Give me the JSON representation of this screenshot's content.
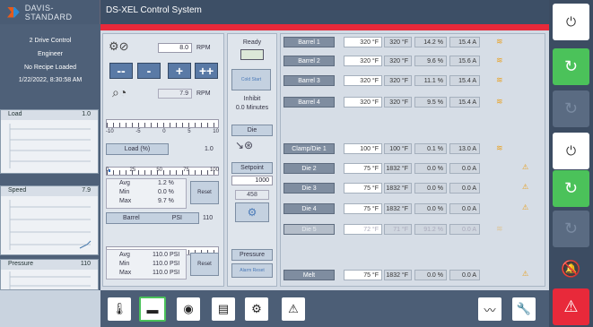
{
  "header": {
    "logo_text": "DAVIS-STANDARD",
    "title": "DS-XEL Control System"
  },
  "sidebar": {
    "system": "2 Drive Control",
    "user": "Engineer",
    "recipe": "No Recipe Loaded",
    "datetime": "1/22/2022, 8:30:58 AM",
    "graphs": [
      {
        "label": "Load",
        "value": "1.0"
      },
      {
        "label": "Speed",
        "value": "7.9"
      },
      {
        "label": "Pressure",
        "value": "110"
      }
    ]
  },
  "drive": {
    "setpoint": "8.0",
    "setpoint_unit": "RPM",
    "actual": "7.9",
    "actual_unit": "RPM",
    "btn_fast_down": "--",
    "btn_down": "-",
    "btn_up": "+",
    "btn_fast_up": "++",
    "scale_top": [
      "-10",
      "-5",
      "0",
      "5",
      "10"
    ],
    "load_label": "Load (%)",
    "load_value": "1.0",
    "load_scale": [
      "0",
      "25",
      "50",
      "75",
      "100"
    ],
    "stats": {
      "avg_label": "Avg",
      "min_label": "Min",
      "max_label": "Max",
      "avg": "1.2 %",
      "min": "0.0 %",
      "max": "9.7 %"
    },
    "reset": "Reset",
    "barrel_label": "Barrel",
    "psi_label": "PSI",
    "barrel_value": "110",
    "pressure_stats": {
      "avg": "110.0 PSI",
      "min": "110.0 PSI",
      "max": "110.0 PSI"
    }
  },
  "status": {
    "ready": "Ready",
    "cold_start": "Cold Start",
    "inhibit": "Inhibit",
    "inhibit_time": "0.0 Minutes",
    "die": "Die",
    "setpoint_label": "Setpoint",
    "setpoint_value": "1000",
    "die_value": "458",
    "pressure": "Pressure",
    "alarm_reset": "Alarm Reset"
  },
  "zones": [
    {
      "name": "Barrel 1",
      "set": "320 °F",
      "act": "320 °F",
      "pct": "14.2 %",
      "amp": "15.4 A",
      "icon": "heat"
    },
    {
      "name": "Barrel 2",
      "set": "320 °F",
      "act": "320 °F",
      "pct": "9.6 %",
      "amp": "15.6 A",
      "icon": "heat"
    },
    {
      "name": "Barrel 3",
      "set": "320 °F",
      "act": "320 °F",
      "pct": "11.1 %",
      "amp": "15.4 A",
      "icon": "heat"
    },
    {
      "name": "Barrel 4",
      "set": "320 °F",
      "act": "320 °F",
      "pct": "9.5 %",
      "amp": "15.4 A",
      "icon": "heat"
    },
    {
      "name": "Clamp/Die 1",
      "set": "100 °F",
      "act": "100 °F",
      "pct": "0.1 %",
      "amp": "13.0 A",
      "icon": "heat"
    },
    {
      "name": "Die 2",
      "set": "75 °F",
      "act": "1832 °F",
      "pct": "0.0 %",
      "amp": "0.0 A",
      "icon": "warn"
    },
    {
      "name": "Die 3",
      "set": "75 °F",
      "act": "1832 °F",
      "pct": "0.0 %",
      "amp": "0.0 A",
      "icon": "warn"
    },
    {
      "name": "Die 4",
      "set": "75 °F",
      "act": "1832 °F",
      "pct": "0.0 %",
      "amp": "0.0 A",
      "icon": "warn"
    },
    {
      "name": "Die 5",
      "set": "72 °F",
      "act": "71 °F",
      "pct": "91.2 %",
      "amp": "0.0 A",
      "icon": "heat"
    },
    {
      "name": "Melt",
      "set": "75 °F",
      "act": "1832 °F",
      "pct": "0.0 %",
      "amp": "0.0 A",
      "icon": "warn"
    }
  ],
  "colors": {
    "header": "#3d4f66",
    "alarm_bar": "#e8293a",
    "green_btn": "#4bc25a",
    "orange": "#f0922a"
  }
}
